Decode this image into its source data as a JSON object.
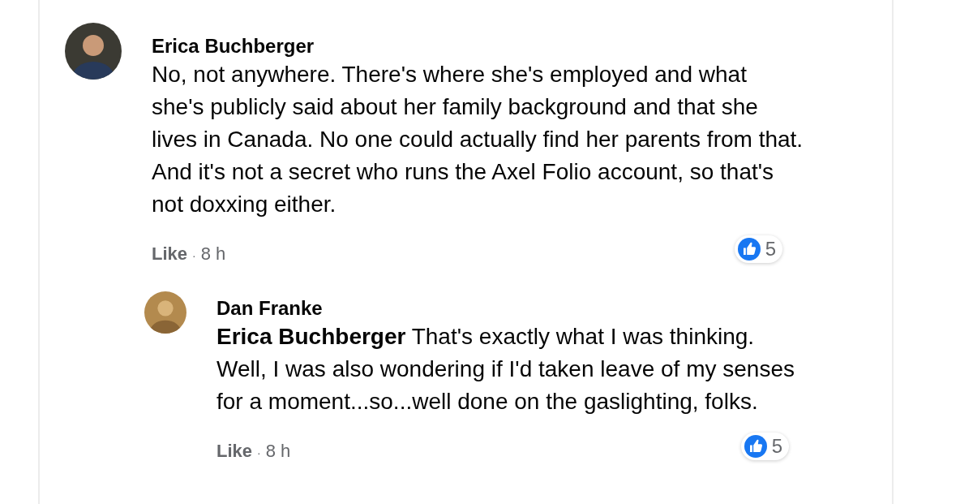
{
  "comments": [
    {
      "author": "Erica Buchberger",
      "text": "No, not anywhere. There's where she's employed and what she's publicly said about her family background and that she lives in Canada. No one could actually find her parents from that. And it's not a secret who runs the Axel Folio account, so that's not doxxing either.",
      "action": "Like",
      "separator": "·",
      "time": "8 h",
      "reactions": "5",
      "kind": "comment",
      "replies": [
        {
          "author": "Dan Franke",
          "text": "**Erica Buchberger** That's exactly what I was thinking. Well, I was also wondering if I'd taken leave of my senses for a moment...so...well done on the gaslighting, folks.",
          "action": "Like",
          "separator": "·",
          "time": "8 h",
          "reactions": "5",
          "kind": "reply"
        }
      ]
    }
  ]
}
